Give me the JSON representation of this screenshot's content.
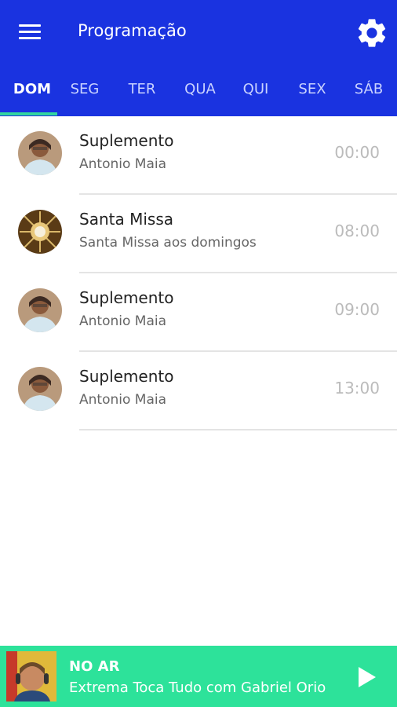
{
  "appbar": {
    "title": "Programação",
    "menu_icon": "hamburger-menu-icon",
    "settings_icon": "gear-icon",
    "color": "#1a33e0"
  },
  "tabs": [
    {
      "label": "DOM",
      "active": true
    },
    {
      "label": "SEG"
    },
    {
      "label": "TER"
    },
    {
      "label": "QUA"
    },
    {
      "label": "QUI"
    },
    {
      "label": "SEX"
    },
    {
      "label": "SÁB"
    }
  ],
  "tab_indicator_color": "#33d6a0",
  "schedule": [
    {
      "title": "Suplemento",
      "subtitle": "Antonio Maia",
      "time": "00:00",
      "avatar": "host-photo"
    },
    {
      "title": "Santa Missa",
      "subtitle": "Santa Missa aos domingos",
      "time": "08:00",
      "avatar": "monstrance-image"
    },
    {
      "title": "Suplemento",
      "subtitle": "Antonio Maia",
      "time": "09:00",
      "avatar": "host-photo"
    },
    {
      "title": "Suplemento",
      "subtitle": "Antonio Maia",
      "time": "13:00",
      "avatar": "host-photo"
    }
  ],
  "player": {
    "label": "NO AR",
    "text": "Extrema Toca Tudo com Gabriel Orio",
    "play_icon": "play-icon",
    "color": "#2de29a"
  }
}
